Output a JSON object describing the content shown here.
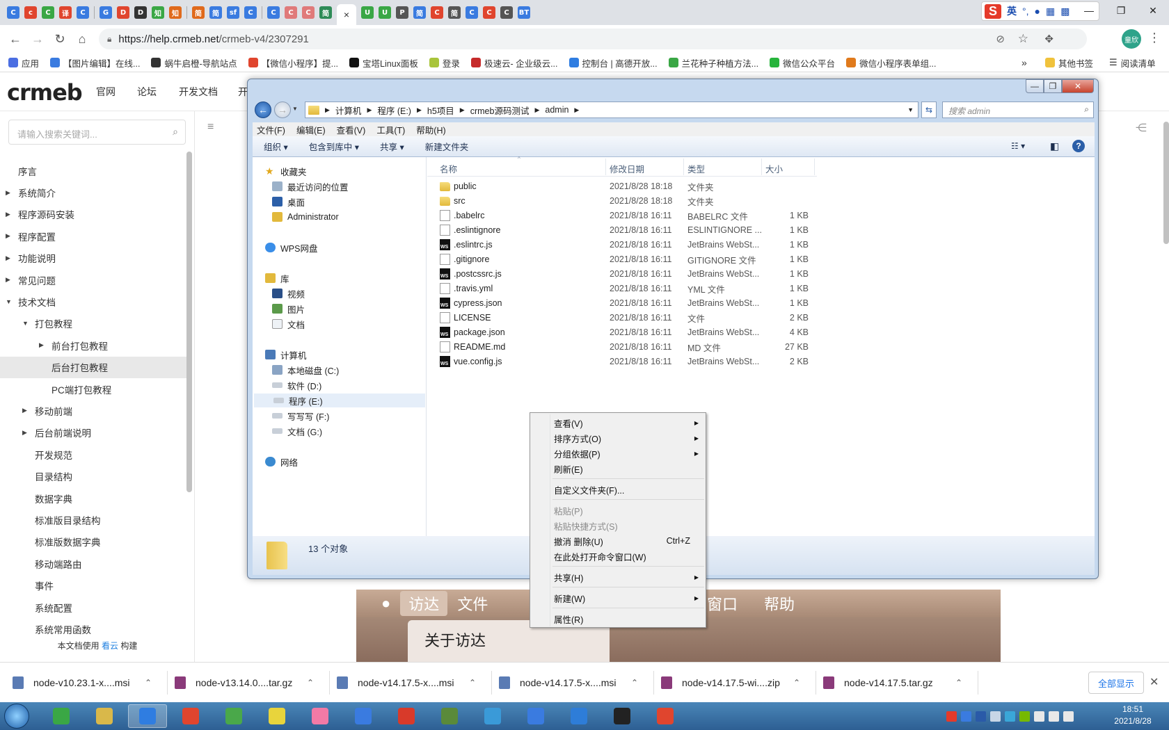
{
  "browser": {
    "tab_glyphs": [
      "C",
      "c",
      "C",
      "译",
      "C",
      "G",
      "D",
      "D",
      "知",
      "知",
      "简",
      "简",
      "sf",
      "C",
      "C",
      "C",
      "C",
      "简"
    ],
    "active_tab_close": "×",
    "tab_glyphs_right": [
      "U",
      "U",
      "P",
      "简",
      "C",
      "简",
      "C",
      "C",
      "C",
      "BT"
    ],
    "ime": {
      "logo": "S",
      "lang": "英"
    },
    "url_host": "https://help.crmeb.net",
    "url_path": "/crmeb-v4/2307291",
    "bookmarks": [
      {
        "label": "应用",
        "color": "#4b6ee2"
      },
      {
        "label": "【图片编辑】在线...",
        "color": "#3a7be0"
      },
      {
        "label": "蜗牛启橙-导航站点",
        "color": "#333333"
      },
      {
        "label": "【微信小程序】提...",
        "color": "#e0452e"
      },
      {
        "label": "宝塔Linux面板",
        "color": "#111111"
      },
      {
        "label": "登录",
        "color": "#a8c43a"
      },
      {
        "label": "极速云- 企业级云...",
        "color": "#c62a2a"
      },
      {
        "label": "控制台 | 高德开放...",
        "color": "#2f7de1"
      },
      {
        "label": "兰花种子种植方法...",
        "color": "#3aa745"
      },
      {
        "label": "微信公众平台",
        "color": "#27b43c"
      },
      {
        "label": "微信小程序表单组...",
        "color": "#e07a1c"
      }
    ],
    "bookmarks_more": "»",
    "other_bookmarks": "其他书签",
    "reading_list": "阅读清单"
  },
  "site": {
    "logo": "crmeb",
    "nav": [
      "官网",
      "论坛",
      "开发文档",
      "开"
    ],
    "search_placeholder": "请输入搜索关键词...",
    "toc": [
      {
        "label": "序言",
        "level": 0,
        "arrow": ""
      },
      {
        "label": "系统简介",
        "level": 0,
        "arrow": "▶"
      },
      {
        "label": "程序源码安装",
        "level": 0,
        "arrow": "▶"
      },
      {
        "label": "程序配置",
        "level": 0,
        "arrow": "▶"
      },
      {
        "label": "功能说明",
        "level": 0,
        "arrow": "▶"
      },
      {
        "label": "常见问题",
        "level": 0,
        "arrow": "▶"
      },
      {
        "label": "技术文档",
        "level": 0,
        "arrow": "▼"
      },
      {
        "label": "打包教程",
        "level": 1,
        "arrow": "▼"
      },
      {
        "label": "前台打包教程",
        "level": 2,
        "arrow": "▶"
      },
      {
        "label": "后台打包教程",
        "level": 2,
        "arrow": "",
        "selected": true
      },
      {
        "label": "PC端打包教程",
        "level": 2,
        "arrow": ""
      },
      {
        "label": "移动前端",
        "level": 1,
        "arrow": "▶"
      },
      {
        "label": "后台前端说明",
        "level": 1,
        "arrow": "▶"
      },
      {
        "label": "开发规范",
        "level": 1,
        "arrow": ""
      },
      {
        "label": "目录结构",
        "level": 1,
        "arrow": ""
      },
      {
        "label": "数据字典",
        "level": 1,
        "arrow": ""
      },
      {
        "label": "标准版目录结构",
        "level": 1,
        "arrow": ""
      },
      {
        "label": "标准版数据字典",
        "level": 1,
        "arrow": ""
      },
      {
        "label": "移动端路由",
        "level": 1,
        "arrow": ""
      },
      {
        "label": "事件",
        "level": 1,
        "arrow": ""
      },
      {
        "label": "系统配置",
        "level": 1,
        "arrow": ""
      },
      {
        "label": "系统常用函数",
        "level": 1,
        "arrow": ""
      }
    ],
    "built_prefix": "本文档使用",
    "built_link": "看云",
    "built_suffix": "构建",
    "mac_menu": [
      "访达",
      "文件"
    ],
    "mac_menu_right": [
      "窗口",
      "帮助"
    ],
    "mac_dropdown": "关于访达"
  },
  "explorer": {
    "breadcrumb": [
      "计算机",
      "程序 (E:)",
      "h5项目",
      "crmeb源码测试",
      "admin"
    ],
    "search_placeholder": "搜索 admin",
    "menubar": [
      "文件(F)",
      "编辑(E)",
      "查看(V)",
      "工具(T)",
      "帮助(H)"
    ],
    "toolbar": [
      "组织 ▾",
      "包含到库中 ▾",
      "共享 ▾",
      "新建文件夹"
    ],
    "nav": {
      "favorites": "收藏夹",
      "recent": "最近访问的位置",
      "desktop": "桌面",
      "admin": "Administrator",
      "wps": "WPS网盘",
      "library": "库",
      "video": "视频",
      "pictures": "图片",
      "docs": "文档",
      "computer": "计算机",
      "drive_c": "本地磁盘 (C:)",
      "drive_d": "软件 (D:)",
      "drive_e": "程序 (E:)",
      "drive_f": "写写写 (F:)",
      "drive_g": "文档 (G:)",
      "network": "网络"
    },
    "columns": [
      "名称",
      "修改日期",
      "类型",
      "大小"
    ],
    "files": [
      {
        "name": "public",
        "date": "2021/8/28 18:18",
        "type": "文件夹",
        "size": "",
        "icon": "folder"
      },
      {
        "name": "src",
        "date": "2021/8/28 18:18",
        "type": "文件夹",
        "size": "",
        "icon": "folder"
      },
      {
        "name": ".babelrc",
        "date": "2021/8/18 16:11",
        "type": "BABELRC 文件",
        "size": "1 KB",
        "icon": "doc"
      },
      {
        "name": ".eslintignore",
        "date": "2021/8/18 16:11",
        "type": "ESLINTIGNORE ...",
        "size": "1 KB",
        "icon": "doc"
      },
      {
        "name": ".eslintrc.js",
        "date": "2021/8/18 16:11",
        "type": "JetBrains WebSt...",
        "size": "1 KB",
        "icon": "ws"
      },
      {
        "name": ".gitignore",
        "date": "2021/8/18 16:11",
        "type": "GITIGNORE 文件",
        "size": "1 KB",
        "icon": "doc"
      },
      {
        "name": ".postcssrc.js",
        "date": "2021/8/18 16:11",
        "type": "JetBrains WebSt...",
        "size": "1 KB",
        "icon": "ws"
      },
      {
        "name": ".travis.yml",
        "date": "2021/8/18 16:11",
        "type": "YML 文件",
        "size": "1 KB",
        "icon": "doc"
      },
      {
        "name": "cypress.json",
        "date": "2021/8/18 16:11",
        "type": "JetBrains WebSt...",
        "size": "1 KB",
        "icon": "ws"
      },
      {
        "name": "LICENSE",
        "date": "2021/8/18 16:11",
        "type": "文件",
        "size": "2 KB",
        "icon": "doc"
      },
      {
        "name": "package.json",
        "date": "2021/8/18 16:11",
        "type": "JetBrains WebSt...",
        "size": "4 KB",
        "icon": "ws"
      },
      {
        "name": "README.md",
        "date": "2021/8/18 16:11",
        "type": "MD 文件",
        "size": "27 KB",
        "icon": "doc"
      },
      {
        "name": "vue.config.js",
        "date": "2021/8/18 16:11",
        "type": "JetBrains WebSt...",
        "size": "2 KB",
        "icon": "ws"
      }
    ],
    "status": "13 个对象"
  },
  "context_menu": {
    "view": "查看(V)",
    "sort": "排序方式(O)",
    "group": "分组依据(P)",
    "refresh": "刷新(E)",
    "customize": "自定义文件夹(F)...",
    "paste": "粘贴(P)",
    "paste_shortcut": "粘贴快捷方式(S)",
    "undo": "撤消 删除(U)",
    "undo_key": "Ctrl+Z",
    "cmd": "在此处打开命令窗口(W)",
    "share": "共享(H)",
    "new": "新建(W)",
    "properties": "属性(R)"
  },
  "downloads": {
    "items": [
      {
        "name": "node-v10.23.1-x....msi",
        "color": "#5a7bb4"
      },
      {
        "name": "node-v13.14.0....tar.gz",
        "color": "#8a3a7a"
      },
      {
        "name": "node-v14.17.5-x....msi",
        "color": "#5a7bb4"
      },
      {
        "name": "node-v14.17.5-x....msi",
        "color": "#5a7bb4"
      },
      {
        "name": "node-v14.17.5-wi....zip",
        "color": "#8a3a7a"
      },
      {
        "name": "node-v14.17.5.tar.gz",
        "color": "#8a3a7a"
      }
    ],
    "show_all": "全部显示"
  },
  "taskbar": {
    "apps": [
      "#3aa745",
      "#d9b84a",
      "#2f7de1",
      "#e0452e",
      "#4aa84a",
      "#e8d43c",
      "#f27aa6",
      "#3a7be0",
      "#d83a2a",
      "#5a8a3a",
      "#3a9ad8",
      "#3a7be0",
      "#2e7dd8",
      "#222222",
      "#e0452e"
    ],
    "active_index": 2,
    "time": "18:51",
    "date": "2021/8/28"
  }
}
